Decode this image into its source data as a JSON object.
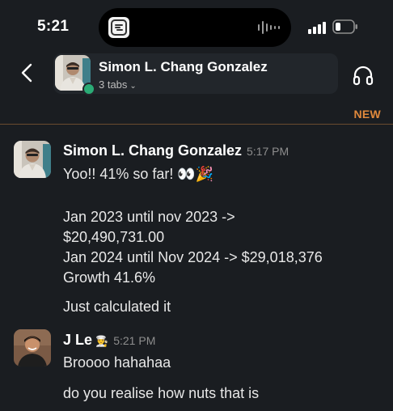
{
  "status": {
    "time": "5:21"
  },
  "header": {
    "contact_name": "Simon L. Chang Gonzalez",
    "tabs_label": "3 tabs",
    "new_label": "NEW"
  },
  "messages": [
    {
      "sender": "Simon L. Chang Gonzalez",
      "time": "5:17 PM",
      "lines": [
        "Yoo!! 41% so far! 👀🎉",
        "Jan 2023 until nov 2023 ->",
        "$20,490,731.00",
        "Jan 2024 until Nov 2024 -> $29,018,376",
        "Growth 41.6%",
        "Just calculated it"
      ]
    },
    {
      "sender": "J Le",
      "sender_badge": "👨‍🍳",
      "time": "5:21 PM",
      "lines": [
        "Broooo hahahaa",
        "do you realise how nuts that is"
      ]
    }
  ],
  "icons": {
    "back": "chevron-left-icon",
    "chevron_tabs": "chevron-down-icon",
    "huddle": "headphones-icon",
    "signal": "cellular-signal-icon",
    "battery": "battery-icon",
    "island_app": "slack-app-icon",
    "island_audio": "audio-waveform-icon"
  },
  "colors": {
    "background": "#1a1d21",
    "new_divider": "#e0893c",
    "presence": "#2bac76"
  }
}
